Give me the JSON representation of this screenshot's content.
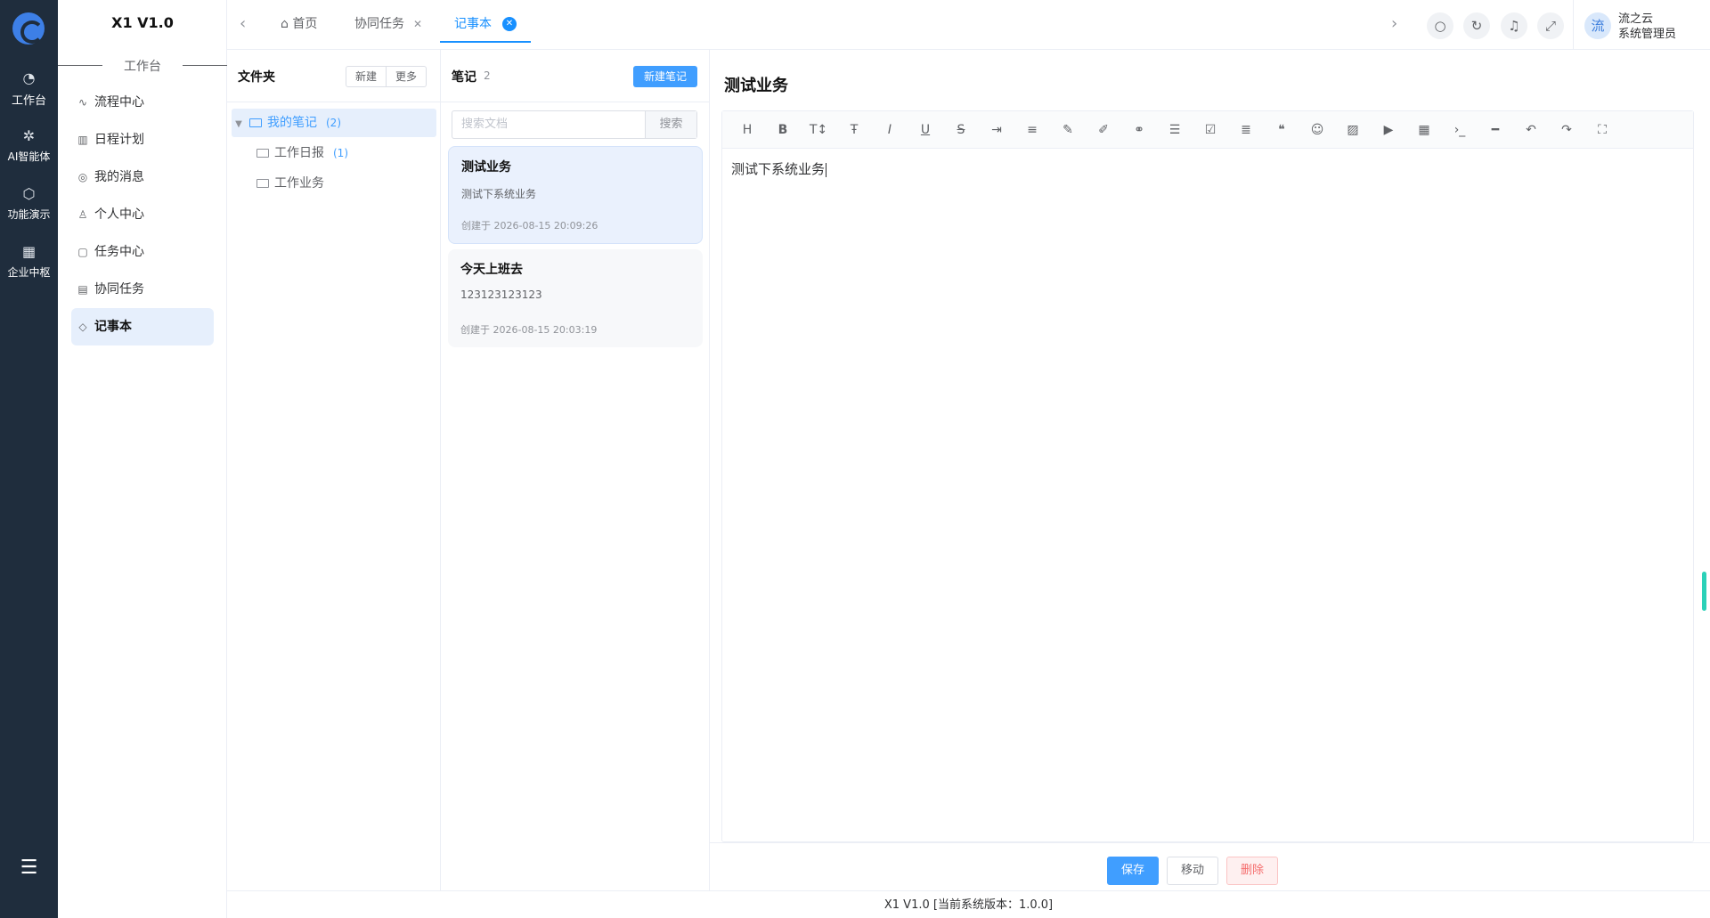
{
  "rail": {
    "items": [
      {
        "label": "工作台",
        "icon": "dashboard-icon"
      },
      {
        "label": "AI智能体",
        "icon": "ai-icon"
      },
      {
        "label": "功能演示",
        "icon": "cube-icon"
      },
      {
        "label": "企业中枢",
        "icon": "apps-icon"
      }
    ]
  },
  "sidebar": {
    "brand": "X1 V1.0",
    "group": "工作台",
    "items": [
      {
        "label": "流程中心"
      },
      {
        "label": "日程计划"
      },
      {
        "label": "我的消息"
      },
      {
        "label": "个人中心"
      },
      {
        "label": "任务中心"
      },
      {
        "label": "协同任务"
      },
      {
        "label": "记事本"
      }
    ]
  },
  "tabs": [
    {
      "label": "首页"
    },
    {
      "label": "协同任务"
    },
    {
      "label": "记事本"
    }
  ],
  "user": {
    "avatar": "流",
    "name": "流之云",
    "role": "系统管理员"
  },
  "folders": {
    "title": "文件夹",
    "new_label": "新建",
    "more_label": "更多",
    "tree": [
      {
        "label": "我的笔记",
        "count": "(2)"
      },
      {
        "label": "工作日报",
        "count": "(1)"
      },
      {
        "label": "工作业务",
        "count": ""
      }
    ]
  },
  "notes": {
    "title": "笔记",
    "count": "2",
    "new_label": "新建笔记",
    "search_placeholder": "搜索文档",
    "search_button": "搜索",
    "items": [
      {
        "title": "测试业务",
        "summary": "测试下系统业务",
        "created": "创建于 2026-08-15 20:09:26"
      },
      {
        "title": "今天上班去",
        "summary": "123123123123",
        "created": "创建于 2026-08-15 20:03:19"
      }
    ]
  },
  "editor": {
    "title": "测试业务",
    "content": "测试下系统业务",
    "save_label": "保存",
    "move_label": "移动",
    "delete_label": "删除"
  },
  "footer": {
    "text": "X1 V1.0 [当前系统版本：1.0.0]"
  },
  "colors": {
    "accent": "#409eff",
    "rail": "#1f2d3d",
    "danger": "#f56c6c"
  }
}
